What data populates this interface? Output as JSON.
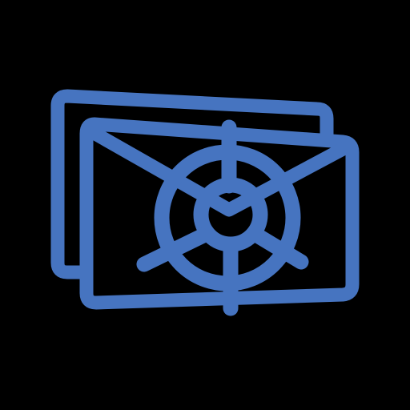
{
  "icon": {
    "name": "mail-vault-icon",
    "stroke_color": "#4674C0",
    "background_color": "#000000"
  }
}
